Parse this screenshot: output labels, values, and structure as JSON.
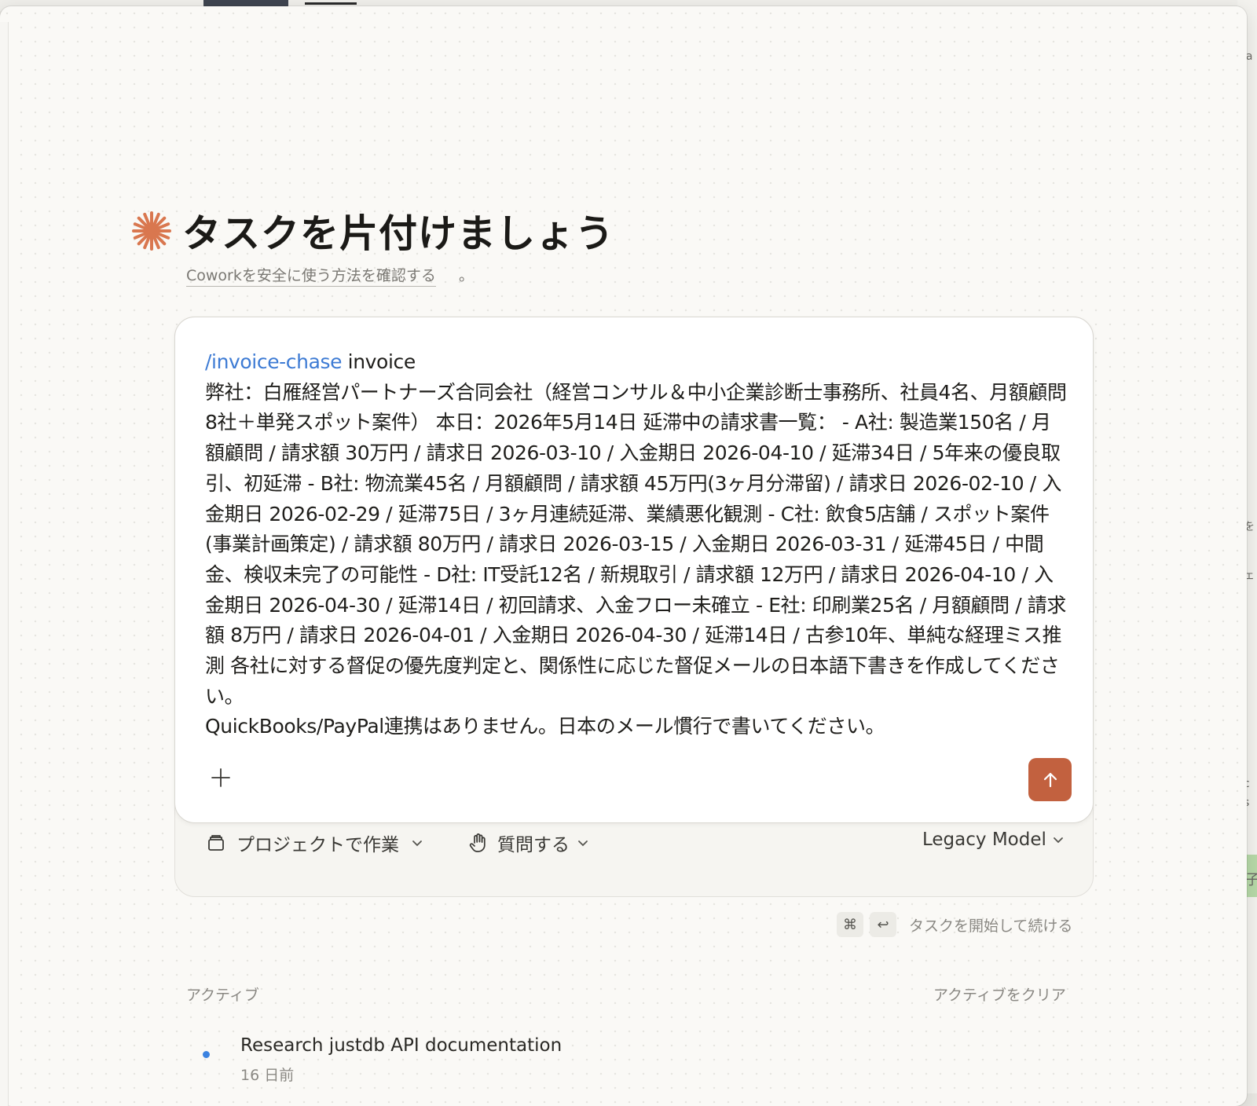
{
  "hero": {
    "title": "タスクを片付けましょう",
    "safety_link": "Coworkを安全に使う方法を確認する",
    "safety_suffix": "。"
  },
  "composer": {
    "command": "/invoice-chase",
    "text": " invoice\n弊社：白雁経営パートナーズ合同会社（経営コンサル＆中小企業診断士事務所、社員4名、月額顧問8社＋単発スポット案件） 本日：2026年5月14日 延滞中の請求書一覧： - A社: 製造業150名 / 月額顧問 / 請求額 30万円 / 請求日 2026-03-10 / 入金期日 2026-04-10 / 延滞34日 / 5年来の優良取引、初延滞 - B社: 物流業45名 / 月額顧問 / 請求額 45万円(3ヶ月分滞留) / 請求日 2026-02-10 / 入金期日 2026-02-29 / 延滞75日 / 3ヶ月連続延滞、業績悪化観測 - C社: 飲食5店舗 / スポット案件(事業計画策定) / 請求額 80万円 / 請求日 2026-03-15 / 入金期日 2026-03-31 / 延滞45日 / 中間金、検収未完了の可能性 - D社: IT受託12名 / 新規取引 / 請求額 12万円 / 請求日 2026-04-10 / 入金期日 2026-04-30 / 延滞14日 / 初回請求、入金フロー未確立 - E社: 印刷業25名 / 月額顧問 / 請求額 8万円 / 請求日 2026-04-01 / 入金期日 2026-04-30 / 延滞14日 / 古参10年、単純な経理ミス推測 各社に対する督促の優先度判定と、関係性に応じた督促メールの日本語下書きを作成してください。\nQuickBooks/PayPal連携はありません。日本のメール慣行で書いてください。",
    "accent_color": "#c2613f",
    "command_color": "#3d7bd4",
    "plus_icon": "plus-icon",
    "send_icon": "arrow-up-icon"
  },
  "toolbar": {
    "project_label": "プロジェクトで作業",
    "ask_label": "質問する",
    "model_label": "Legacy Model"
  },
  "shortcut": {
    "key1": "⌘",
    "key2": "↩",
    "hint": "タスクを開始して続ける"
  },
  "active": {
    "label": "アクティブ",
    "clear_label": "アクティブをクリア",
    "tasks": [
      {
        "title": "Research justdb API documentation",
        "age": "16 日前",
        "status_color": "#3b82e0"
      }
    ]
  },
  "background_fragments": [
    "ha",
    "。",
    "を",
    "ェ",
    "c",
    "s",
    "子"
  ]
}
